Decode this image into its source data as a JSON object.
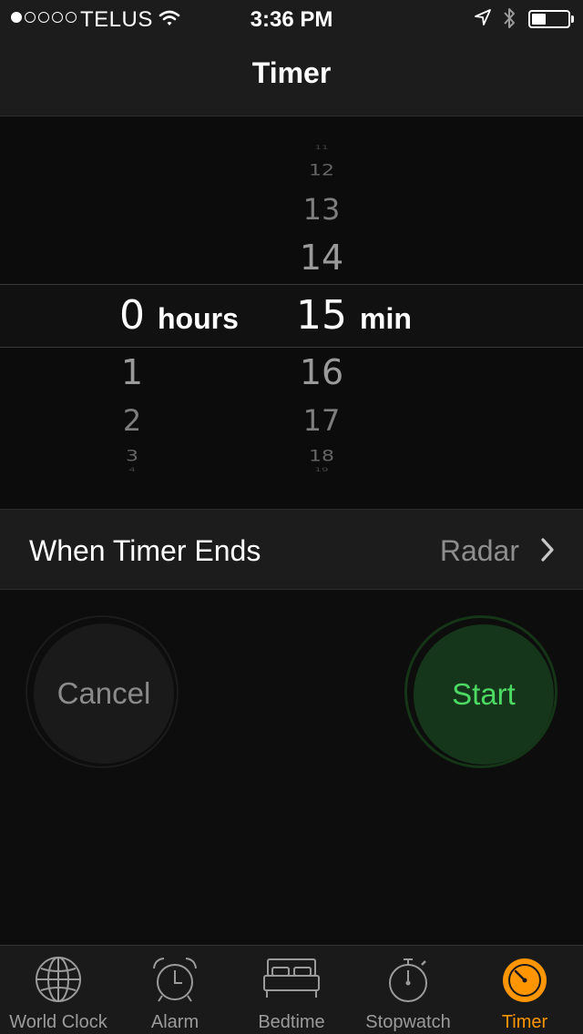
{
  "status_bar": {
    "carrier": "TELUS",
    "time": "3:36 PM",
    "signal_bars_filled": 1,
    "signal_bars_total": 5,
    "battery_level": 0.4
  },
  "nav": {
    "title": "Timer"
  },
  "picker": {
    "hours": {
      "above": [
        "",
        "",
        ""
      ],
      "selected": "0",
      "below": [
        "1",
        "2",
        "3",
        "4"
      ],
      "unit": "hours"
    },
    "minutes": {
      "above": [
        "11",
        "12",
        "13",
        "14"
      ],
      "selected": "15",
      "below": [
        "16",
        "17",
        "18",
        "19"
      ],
      "unit": "min"
    }
  },
  "timer_ends": {
    "label": "When Timer Ends",
    "value": "Radar"
  },
  "buttons": {
    "cancel": "Cancel",
    "start": "Start"
  },
  "tabs": [
    {
      "label": "World Clock",
      "icon": "globe-icon"
    },
    {
      "label": "Alarm",
      "icon": "alarm-clock-icon"
    },
    {
      "label": "Bedtime",
      "icon": "bed-icon"
    },
    {
      "label": "Stopwatch",
      "icon": "stopwatch-icon"
    },
    {
      "label": "Timer",
      "icon": "timer-icon",
      "active": true
    }
  ],
  "colors": {
    "accent_active_tab": "#ff9500",
    "start_text": "#4cd964",
    "start_fill": "#16361b",
    "cancel_text": "#8a8a8a",
    "background": "#0d0d0d"
  }
}
